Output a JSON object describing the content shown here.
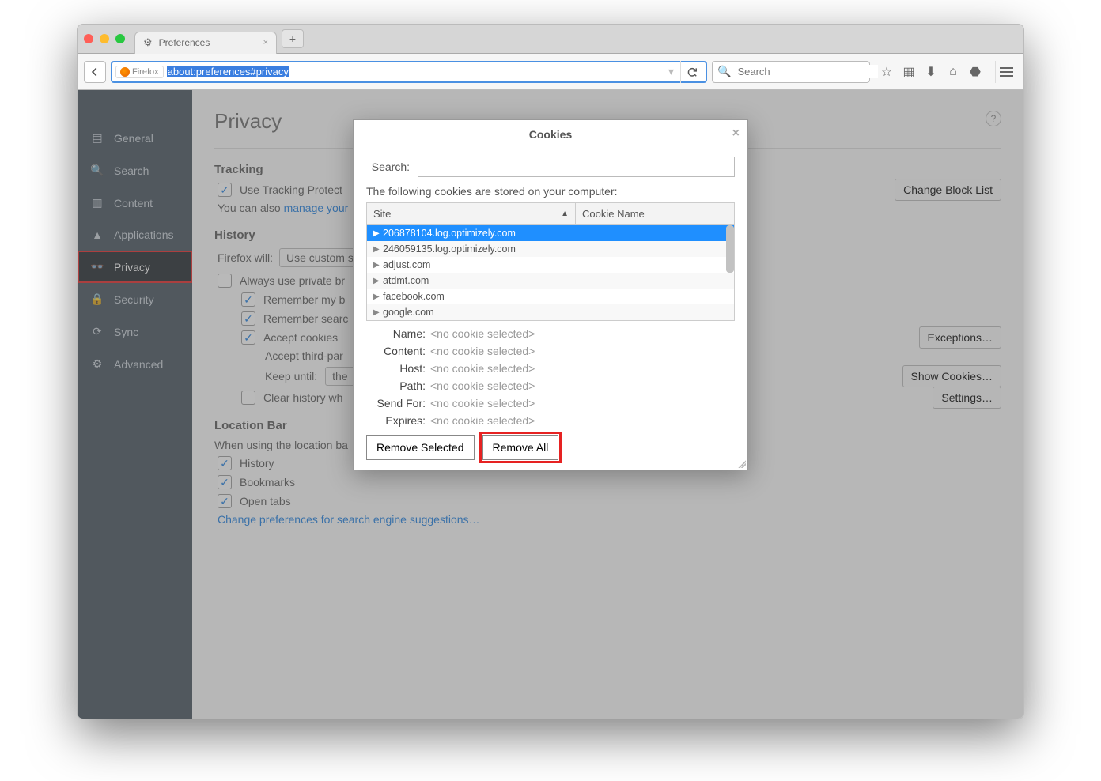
{
  "tab": {
    "title": "Preferences"
  },
  "url": {
    "identity": "Firefox",
    "path": "about:preferences#privacy"
  },
  "search": {
    "placeholder": "Search"
  },
  "sidebar": {
    "items": [
      "General",
      "Search",
      "Content",
      "Applications",
      "Privacy",
      "Security",
      "Sync",
      "Advanced"
    ],
    "icons": [
      "▤",
      "🔍",
      "▥",
      "▲",
      "👓",
      "🔒",
      "⟳",
      "⚙"
    ],
    "active": 4
  },
  "page": {
    "title": "Privacy",
    "tracking_header": "Tracking",
    "tracking_checkbox": "Use Tracking Protect",
    "change_blocklist": "Change Block List",
    "manage_line_a": "You can also ",
    "manage_line_b": "manage your",
    "history_header": "History",
    "firefox_will": "Firefox will:",
    "firefox_will_value": "Use custom s",
    "always_private": "Always use private br",
    "remember_browsing": "Remember my b",
    "remember_search": "Remember searc",
    "accept_cookies": "Accept cookies",
    "accept_third": "Accept third-par",
    "keep_until": "Keep until:",
    "keep_until_value": "the",
    "clear_history": "Clear history wh",
    "location_header": "Location Bar",
    "location_sub": "When using the location ba",
    "lb_history": "History",
    "lb_bookmarks": "Bookmarks",
    "lb_opentabs": "Open tabs",
    "change_search": "Change preferences for search engine suggestions…",
    "exceptions": "Exceptions…",
    "show_cookies": "Show Cookies…",
    "settings": "Settings…"
  },
  "dialog": {
    "title": "Cookies",
    "search_label": "Search:",
    "stored_text": "The following cookies are stored on your computer:",
    "col_site": "Site",
    "col_name": "Cookie Name",
    "rows": [
      "206878104.log.optimizely.com",
      "246059135.log.optimizely.com",
      "adjust.com",
      "atdmt.com",
      "facebook.com",
      "google.com"
    ],
    "selected": 0,
    "details_keys": [
      "Name:",
      "Content:",
      "Host:",
      "Path:",
      "Send For:",
      "Expires:"
    ],
    "no_cookie": "<no cookie selected>",
    "remove_selected": "Remove Selected",
    "remove_all": "Remove All"
  }
}
